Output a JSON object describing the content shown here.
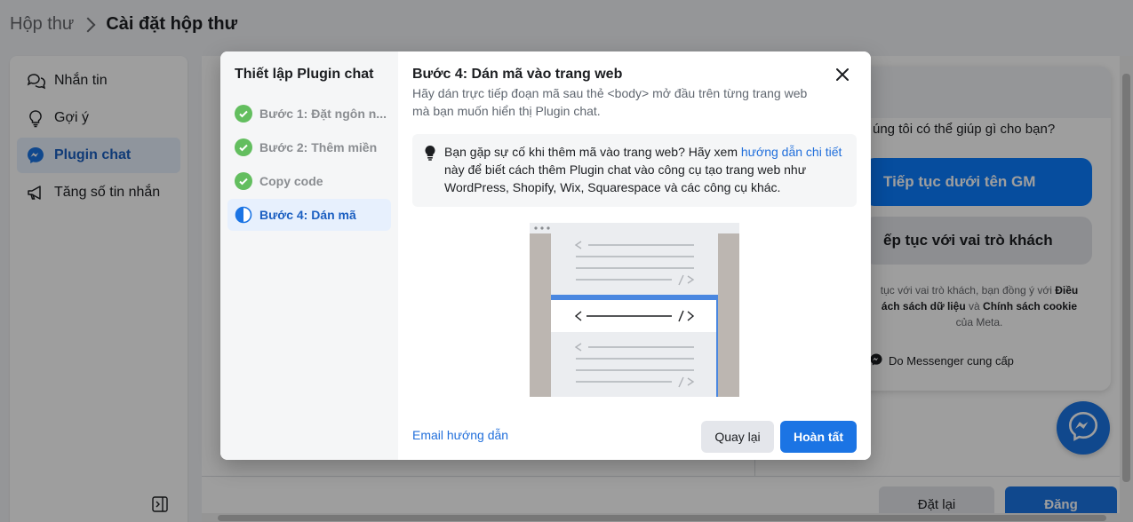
{
  "breadcrumb": {
    "parent": "Hộp thư",
    "current": "Cài đặt hộp thư"
  },
  "sidebar": {
    "items": [
      {
        "label": "Nhắn tin",
        "icon": "chat-bubbles-icon"
      },
      {
        "label": "Gợi ý",
        "icon": "lightbulb-icon"
      },
      {
        "label": "Plugin chat",
        "icon": "messenger-icon",
        "active": true
      },
      {
        "label": "Tăng số tin nhắn",
        "icon": "megaphone-icon"
      }
    ]
  },
  "preview": {
    "question": "úng tôi có thể giúp gì cho bạn?",
    "continue_as": "Tiếp tục dưới tên GM",
    "guest": "ếp tục với vai trò khách",
    "terms_prefix": "tục với vai trò khách, bạn đồng ý với",
    "terms_link1": "Điều",
    "terms_link2": "ách sách dữ liệu",
    "terms_and": "và",
    "terms_link3": "Chính sách cookie",
    "terms_suffix": "của Meta.",
    "powered_by": "Do Messenger cung cấp"
  },
  "footer": {
    "reset": "Đặt lại",
    "post": "Đăng"
  },
  "modal": {
    "steps_title": "Thiết lập Plugin chat",
    "steps": [
      {
        "label": "Bước 1: Đặt ngôn n...",
        "state": "done"
      },
      {
        "label": "Bước 2: Thêm miền",
        "state": "done"
      },
      {
        "label": "Copy code",
        "state": "done"
      },
      {
        "label": "Bước 4: Dán mã",
        "state": "active"
      }
    ],
    "title": "Bước 4: Dán mã vào trang web",
    "subtitle": "Hãy dán trực tiếp đoạn mã sau thẻ <body> mở đầu trên từng trang web mà bạn muốn hiển thị Plugin chat.",
    "tip_before": "Bạn gặp sự cố khi thêm mã vào trang web? Hãy xem",
    "tip_link": "hướng dẫn chi tiết",
    "tip_after": "này để biết cách thêm Plugin chat vào công cụ tạo trang web như WordPress, Shopify, Wix, Squarespace và các công cụ khác.",
    "email_link": "Email hướng dẫn",
    "back": "Quay lại",
    "done": "Hoàn tất"
  },
  "colors": {
    "accent": "#1b74e4",
    "success": "#63be5f",
    "active_bg": "#e7f0fd"
  }
}
